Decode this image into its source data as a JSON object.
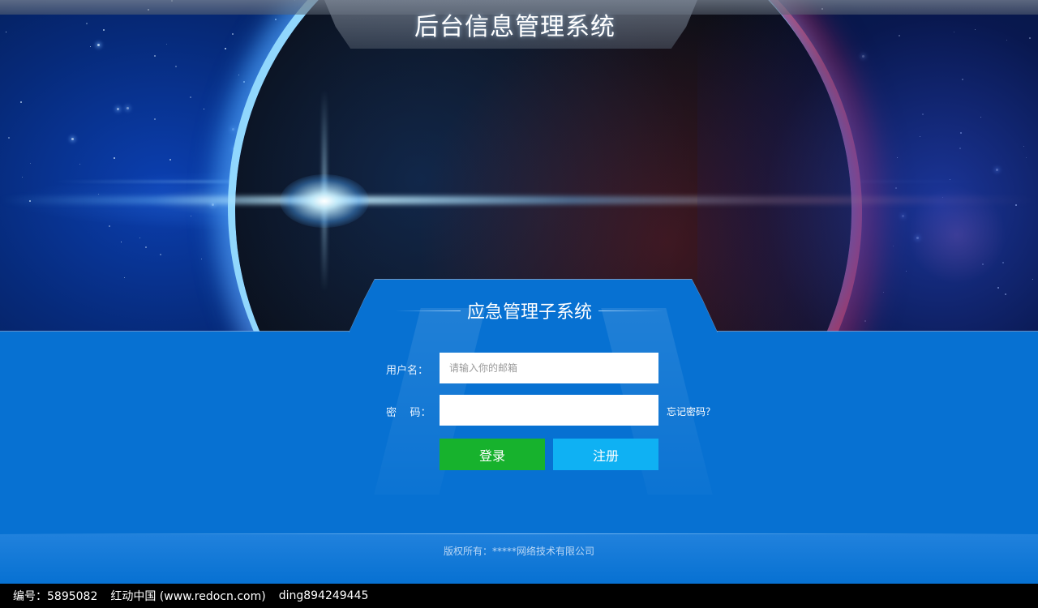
{
  "header": {
    "title": "后台信息管理系统"
  },
  "login": {
    "title": "应急管理子系统",
    "username_label": "用户名：",
    "username_placeholder": "请输入你的邮箱",
    "username_value": "",
    "password_label": "密    码：",
    "password_value": "",
    "forgot_label": "忘记密码？",
    "login_button": "登录",
    "register_button": "注册"
  },
  "footer": {
    "copyright": "版权所有：*****网络技术有限公司"
  },
  "watermark": {
    "id_text": "编号：5895082",
    "site_text": "红动中国 (www.redocn.com)",
    "author_text": "ding894249445"
  },
  "colors": {
    "panel_blue": "#0771d2",
    "login_green": "#17b22d",
    "register_cyan": "#0fb1f3"
  }
}
